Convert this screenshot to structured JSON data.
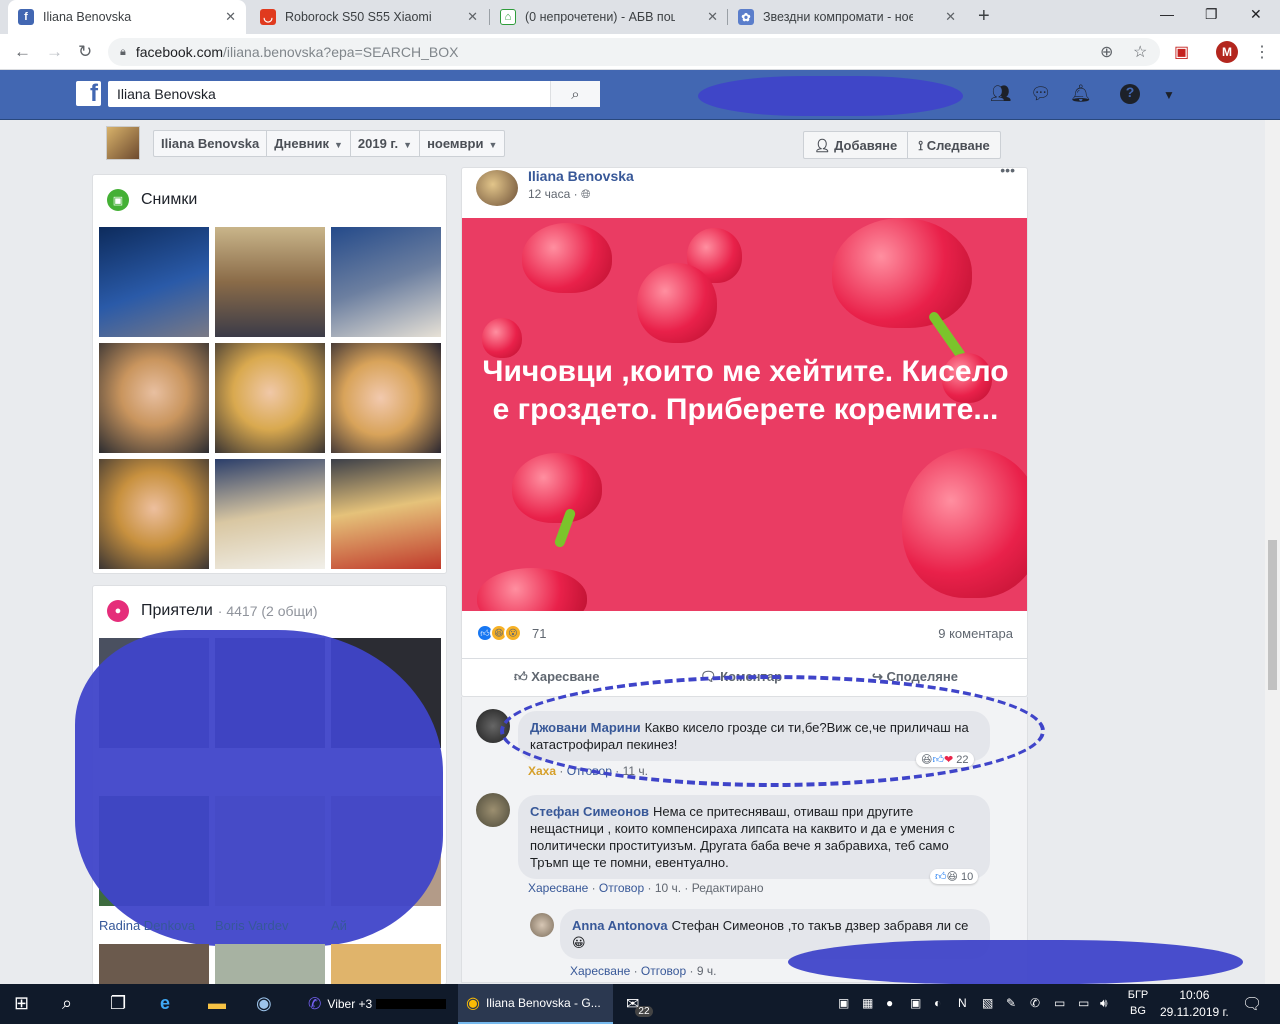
{
  "browser": {
    "tabs": [
      {
        "title": "Iliana Benovska",
        "active": true,
        "icon": "facebook-icon",
        "color": "#4267b2"
      },
      {
        "title": "Roborock S50 S55 Xiaomi Vacuum",
        "active": false,
        "icon": "shop-icon",
        "color": "#e03a1e"
      },
      {
        "title": "(0 непрочетени) - АБВ поща",
        "active": false,
        "icon": "home-mail-icon",
        "color": "#2e9c3a"
      },
      {
        "title": "Звездни компромати - ноември",
        "active": false,
        "icon": "blog-icon",
        "color": "#5b7ecb"
      }
    ],
    "url_host": "facebook.com",
    "url_path": "/iliana.benovska?epa=SEARCH_BOX",
    "profile_initial": "M"
  },
  "fb": {
    "search_value": "Iliana Benovska",
    "subbar": {
      "crumbs": [
        "Iliana Benovska",
        "Дневник",
        "2019 г.",
        "ноември"
      ],
      "add_label": "Добавяне",
      "follow_label": "Следване"
    },
    "photos_title": "Снимки",
    "friends": {
      "title": "Приятели",
      "count": "4417 (2 общи)",
      "names": [
        "Radina Denkova",
        "Boris Vardev",
        "Ай"
      ]
    },
    "post": {
      "author": "Iliana Benovska",
      "time": "12 часа",
      "text": "Чичовци ,които ме хейтите. Кисело е гроздето. Приберете коремите...",
      "reaction_count": "71",
      "comment_count": "9 коментара",
      "actions": {
        "like": "Харесване",
        "comment": "Коментар",
        "share": "Споделяне"
      }
    },
    "comments": [
      {
        "author": "Джовани Марини",
        "text": "Какво кисело грозде си ти,бе?Виж се,че приличаш на катастрофирал пекинез!",
        "meta_reaction": "Хаха",
        "reply": "Отговор",
        "time": "11 ч.",
        "reactions": "22"
      },
      {
        "author": "Стефан Симеонов",
        "text": "Нема се притесняваш, отиваш при другите нещастници , които компенсираха липсата на каквито и да е умения с политически проституизъм. Другата баба вече я забравиха, теб само Тръмп ще те помни, евентуално.",
        "like": "Харесване",
        "reply": "Отговор",
        "time": "10 ч.",
        "edited": "Редактирано",
        "reactions": "10"
      },
      {
        "author": "Anna Antonova",
        "text": "Стефан Симеонов ,то такъв дзвер забравя ли се",
        "like": "Харесване",
        "reply": "Отговор",
        "time": "9 ч."
      }
    ]
  },
  "taskbar": {
    "apps": [
      {
        "label": "Viber +3",
        "icon": "viber-icon"
      },
      {
        "label": "Iliana Benovska - G...",
        "icon": "chrome-icon",
        "active": true
      },
      {
        "label": "22",
        "icon": "mail-icon"
      }
    ],
    "lang_top": "БГР",
    "lang_bottom": "BG",
    "time": "10:06",
    "date": "29.11.2019 г."
  },
  "colors": {
    "fb_blue": "#4267b2",
    "post_bg": "#ea3c63",
    "link": "#385898",
    "redaction": "#3f44c9"
  }
}
